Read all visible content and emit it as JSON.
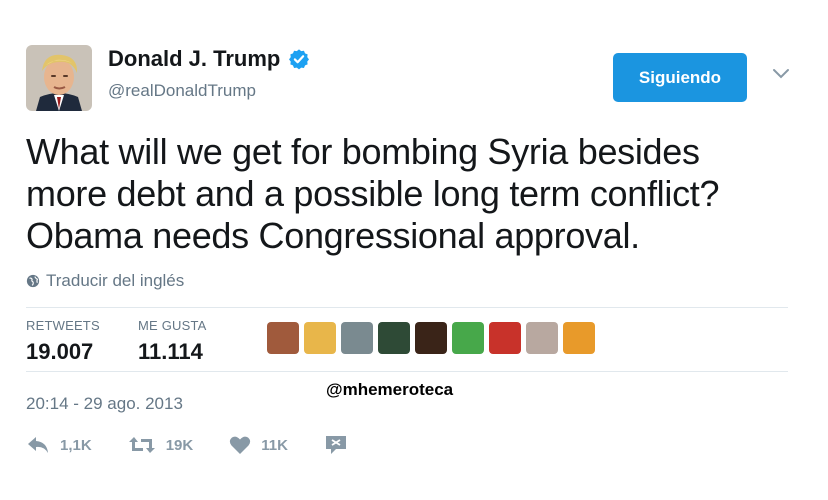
{
  "author": {
    "name": "Donald J. Trump",
    "handle": "@realDonaldTrump",
    "verified_icon": "verified-badge-icon",
    "avatar_icon": "profile-avatar"
  },
  "follow_button": {
    "label": "Siguiendo",
    "color": "#1b95e0"
  },
  "tweet": {
    "lines": [
      "What will we get for bombing Syria besides",
      "more debt and a possible long term conflict?",
      "Obama needs Congressional approval."
    ]
  },
  "translate": {
    "label": "Traducir del inglés",
    "icon": "globe-icon"
  },
  "stats": {
    "retweets": {
      "label": "RETWEETS",
      "value": "19.007"
    },
    "likes": {
      "label": "ME GUSTA",
      "value": "11.114"
    }
  },
  "liker_avatars": [
    "#a05a3c",
    "#e8b64a",
    "#7a8a90",
    "#2e4a36",
    "#3a2418",
    "#47a84a",
    "#c8322a",
    "#b8a8a0",
    "#e89a2a"
  ],
  "watermark": "@mhemeroteca",
  "timestamp": "20:14 - 29 ago. 2013",
  "actions": {
    "reply": {
      "icon": "reply-icon",
      "count": "1,1K"
    },
    "retweet": {
      "icon": "retweet-icon",
      "count": "19K"
    },
    "like": {
      "icon": "heart-icon",
      "count": "11K"
    },
    "message": {
      "icon": "direct-message-icon"
    }
  },
  "colors": {
    "text": "#14171a",
    "secondary": "#657786",
    "accent": "#1b95e0",
    "action": "#8899a6"
  }
}
